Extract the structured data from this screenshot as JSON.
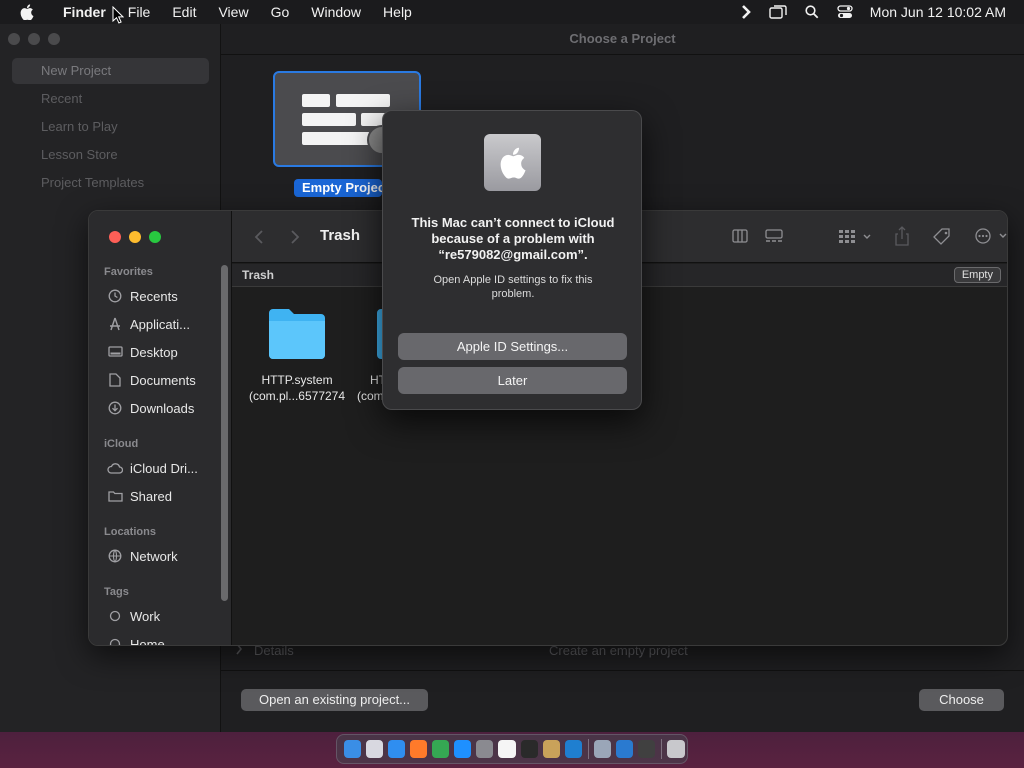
{
  "menubar": {
    "apple_icon": "apple-logo-icon",
    "app_name": "Finder",
    "items": [
      "File",
      "Edit",
      "View",
      "Go",
      "Window",
      "Help"
    ],
    "status_icons": [
      "chevron-right-icon",
      "screen-mirroring-icon",
      "spotlight-search-icon",
      "control-center-icon"
    ],
    "clock": "Mon Jun 12  10:02 AM"
  },
  "playgrounds": {
    "window_title": "Choose a Project",
    "sidebar": [
      "New Project",
      "Recent",
      "Learn to Play",
      "Lesson Store",
      "Project Templates"
    ],
    "template_label": "Empty Project",
    "details_label": "Details",
    "details_desc": "Create an empty project",
    "open_button": "Open an existing project...",
    "choose_button": "Choose"
  },
  "finder": {
    "title": "Trash",
    "path": "Trash",
    "empty_button": "Empty",
    "sections": {
      "favorites": "Favorites",
      "icloud": "iCloud",
      "locations": "Locations",
      "tags": "Tags"
    },
    "favorites": [
      {
        "label": "Recents",
        "icon": "clock-icon"
      },
      {
        "label": "Applicati...",
        "icon": "applications-icon"
      },
      {
        "label": "Desktop",
        "icon": "desktop-icon"
      },
      {
        "label": "Documents",
        "icon": "document-icon"
      },
      {
        "label": "Downloads",
        "icon": "download-icon"
      }
    ],
    "icloud": [
      {
        "label": "iCloud Dri...",
        "icon": "cloud-icon"
      },
      {
        "label": "Shared",
        "icon": "shared-folder-icon"
      }
    ],
    "locations": [
      {
        "label": "Network",
        "icon": "globe-icon"
      }
    ],
    "tags": [
      {
        "label": "Work",
        "icon": "tag-dot-icon"
      },
      {
        "label": "Home",
        "icon": "tag-dot-icon"
      }
    ],
    "files": [
      {
        "line1": "HTTP.system",
        "line2": "(com.pl...6577274"
      },
      {
        "line1": "HT",
        "line2": "(com"
      }
    ]
  },
  "dialog": {
    "icon": "apple-logo-icon",
    "title": "This Mac can’t connect to iCloud because of a problem with “re579082@gmail.com”.",
    "message": "Open Apple ID settings to fix this problem.",
    "primary_button": "Apple ID Settings...",
    "secondary_button": "Later"
  },
  "dock": {
    "apps": [
      "finder-icon",
      "launchpad-icon",
      "safari-icon",
      "firefox-icon",
      "chrome-icon",
      "app-store-icon",
      "system-settings-icon",
      "textedit-icon",
      "terminal-icon",
      "script-editor-icon",
      "vscode-icon",
      "preview-icon",
      "quicktime-icon",
      "activity-monitor-icon",
      "trash-icon"
    ],
    "colors": [
      "#3a8ee6",
      "#d8d8e0",
      "#2f8ef0",
      "#ff7a2a",
      "#35a853",
      "#1e90ff",
      "#8a8a90",
      "#f5f5f5",
      "#2a2a2a",
      "#c9a25a",
      "#1f7fd0",
      "#9aa6b8",
      "#2a7ad0",
      "#404040",
      "#c8c8cc"
    ]
  }
}
